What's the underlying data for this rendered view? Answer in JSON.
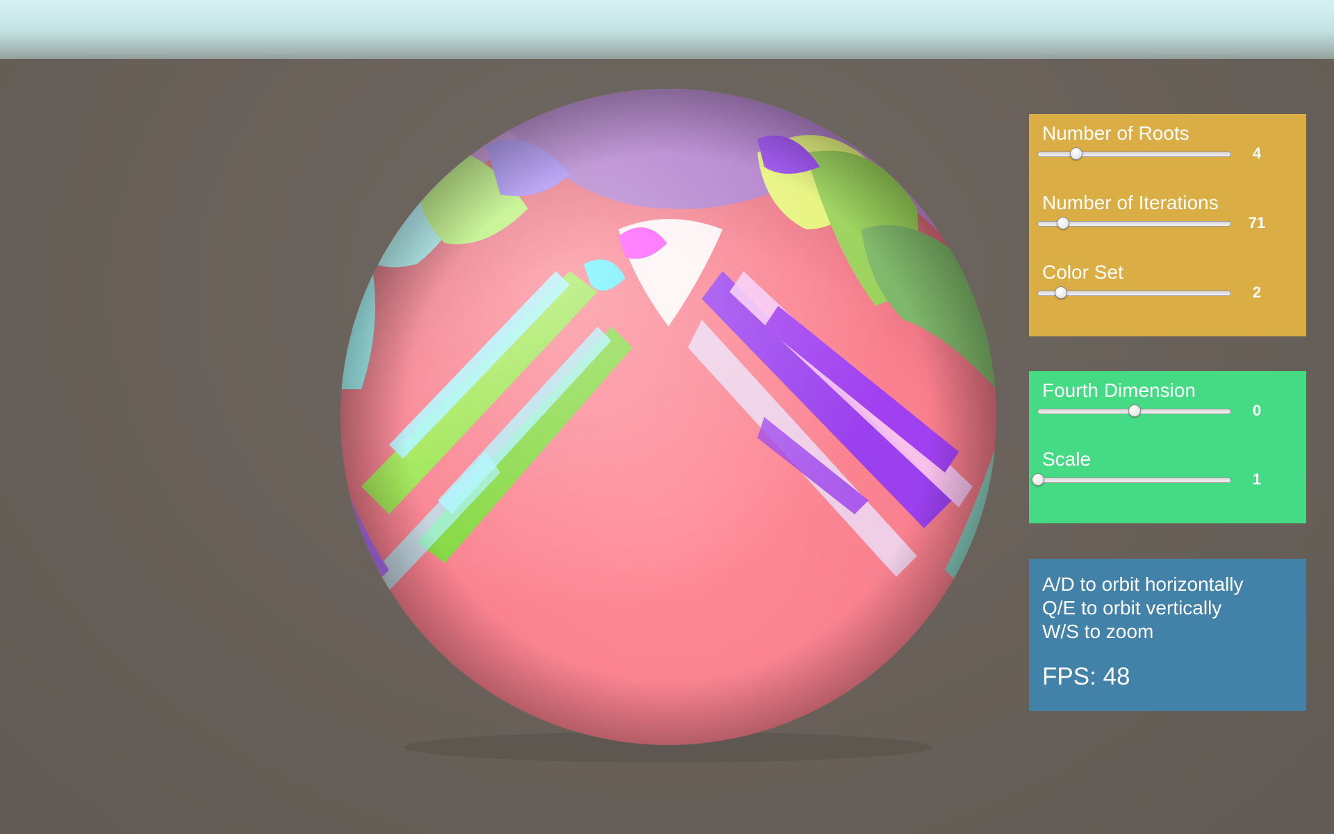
{
  "colors": {
    "sky": "#d6f1f1",
    "ground": "#686059",
    "panel_fractal": "#dbad45",
    "panel_transform": "#45da84",
    "panel_help": "#4282a8"
  },
  "fractal_panel": {
    "sliders": [
      {
        "label": "Number of Roots",
        "value": "4",
        "fraction": 0.2
      },
      {
        "label": "Number of Iterations",
        "value": "71",
        "fraction": 0.13
      },
      {
        "label": "Color Set",
        "value": "2",
        "fraction": 0.12
      }
    ]
  },
  "transform_panel": {
    "sliders": [
      {
        "label": "Fourth Dimension",
        "value": "0",
        "fraction": 0.5
      },
      {
        "label": "Scale",
        "value": "1",
        "fraction": 0.0
      }
    ]
  },
  "help_panel": {
    "lines": [
      "A/D to orbit horizontally",
      "Q/E to orbit vertically",
      "W/S to zoom"
    ],
    "fps": "FPS: 48"
  }
}
